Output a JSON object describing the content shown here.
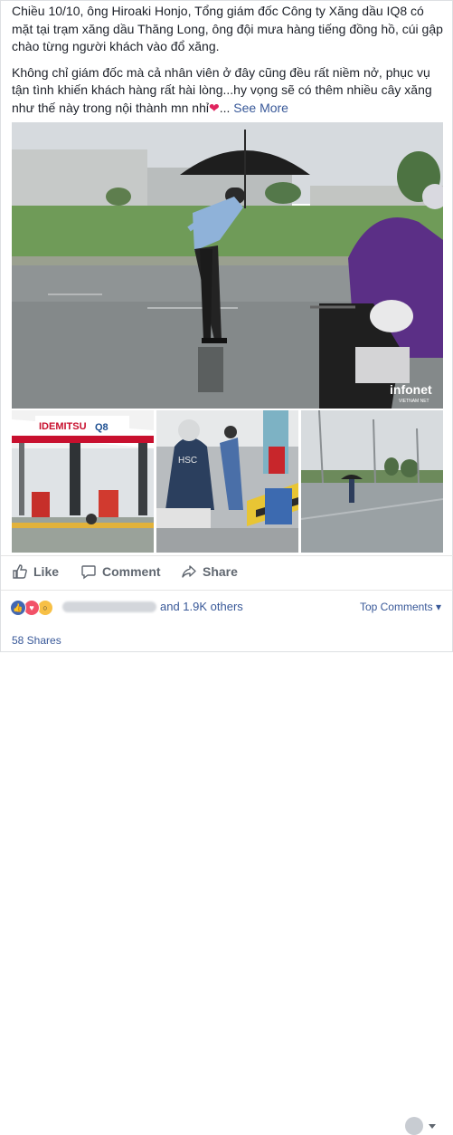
{
  "post": {
    "paragraph1": "Chiều 10/10, ông Hiroaki Honjo, Tổng giám đốc Công ty Xăng dầu IQ8 có mặt tại trạm xăng dầu Thăng Long, ông đội mưa hàng tiếng đồng hồ, cúi gập chào từng người khách vào đổ xăng.",
    "paragraph2": "Không chỉ giám đốc mà cả nhân viên ở đây cũng đều rất niềm nở, phục vụ tận tình khiến khách hàng rất hài lòng...hy vọng sẽ có thêm nhiều cây xăng như thế này trong nội thành mn nhỉ",
    "heart_emoji": "❤",
    "ellipsis": "...",
    "see_more": "See More"
  },
  "photos": {
    "main_watermark": "infonet",
    "main_watermark_sub": "VIETNAM NET",
    "p1_sign_brand": "IDEMITSU",
    "p1_sign_q8": "Q8",
    "p2_shirt": "HSC"
  },
  "actions": {
    "like": "Like",
    "comment": "Comment",
    "share": "Share"
  },
  "reactions": {
    "others": "and 1.9K others",
    "top_comments": "Top Comments",
    "shares": "58 Shares"
  },
  "colors": {
    "link": "#385898",
    "action_text": "#606770",
    "like_blue": "#4267b2",
    "love_red": "#f25268",
    "wow_yellow": "#f7c046"
  }
}
